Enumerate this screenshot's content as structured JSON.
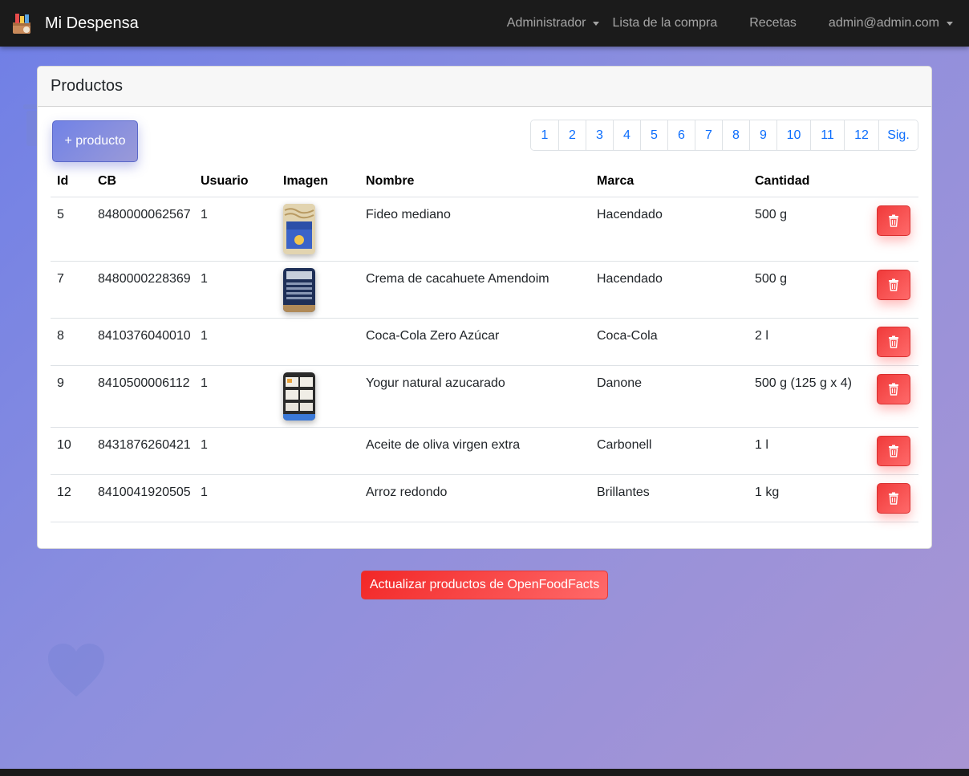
{
  "navbar": {
    "brand": "Mi Despensa",
    "items": [
      {
        "label": "Administrador",
        "dropdown": true
      },
      {
        "label": "Lista de la compra",
        "dropdown": false
      },
      {
        "label": "Recetas",
        "dropdown": false
      },
      {
        "label": "admin@admin.com",
        "dropdown": true
      }
    ]
  },
  "card": {
    "title": "Productos",
    "add_button": "+ producto"
  },
  "pagination": [
    "1",
    "2",
    "3",
    "4",
    "5",
    "6",
    "7",
    "8",
    "9",
    "10",
    "11",
    "12",
    "Sig."
  ],
  "table": {
    "headers": [
      "Id",
      "CB",
      "Usuario",
      "Imagen",
      "Nombre",
      "Marca",
      "Cantidad"
    ],
    "rows": [
      {
        "id": "5",
        "cb": "8480000062567",
        "usuario": "1",
        "image": "pasta-package",
        "nombre": "Fideo mediano",
        "marca": "Hacendado",
        "cantidad": "500 g"
      },
      {
        "id": "7",
        "cb": "8480000228369",
        "usuario": "1",
        "image": "peanut-butter-jar",
        "nombre": "Crema de cacahuete Amendoim",
        "marca": "Hacendado",
        "cantidad": "500 g"
      },
      {
        "id": "8",
        "cb": "8410376040010",
        "usuario": "1",
        "image": null,
        "nombre": "Coca-Cola Zero Azúcar",
        "marca": "Coca-Cola",
        "cantidad": "2 l"
      },
      {
        "id": "9",
        "cb": "8410500006112",
        "usuario": "1",
        "image": "yogurt-pack",
        "nombre": "Yogur natural azucarado",
        "marca": "Danone",
        "cantidad": "500 g (125 g x 4)"
      },
      {
        "id": "10",
        "cb": "8431876260421",
        "usuario": "1",
        "image": null,
        "nombre": "Aceite de oliva virgen extra",
        "marca": "Carbonell",
        "cantidad": "1 l"
      },
      {
        "id": "12",
        "cb": "8410041920505",
        "usuario": "1",
        "image": null,
        "nombre": "Arroz redondo",
        "marca": "Brillantes",
        "cantidad": "1 kg"
      }
    ]
  },
  "update_button": "Actualizar productos de OpenFoodFacts",
  "colors": {
    "navbar": "#1b1b1b",
    "accent_blue": "#0d6efd",
    "danger": "#f03a3a",
    "primary_gradient": "#7182e6"
  }
}
